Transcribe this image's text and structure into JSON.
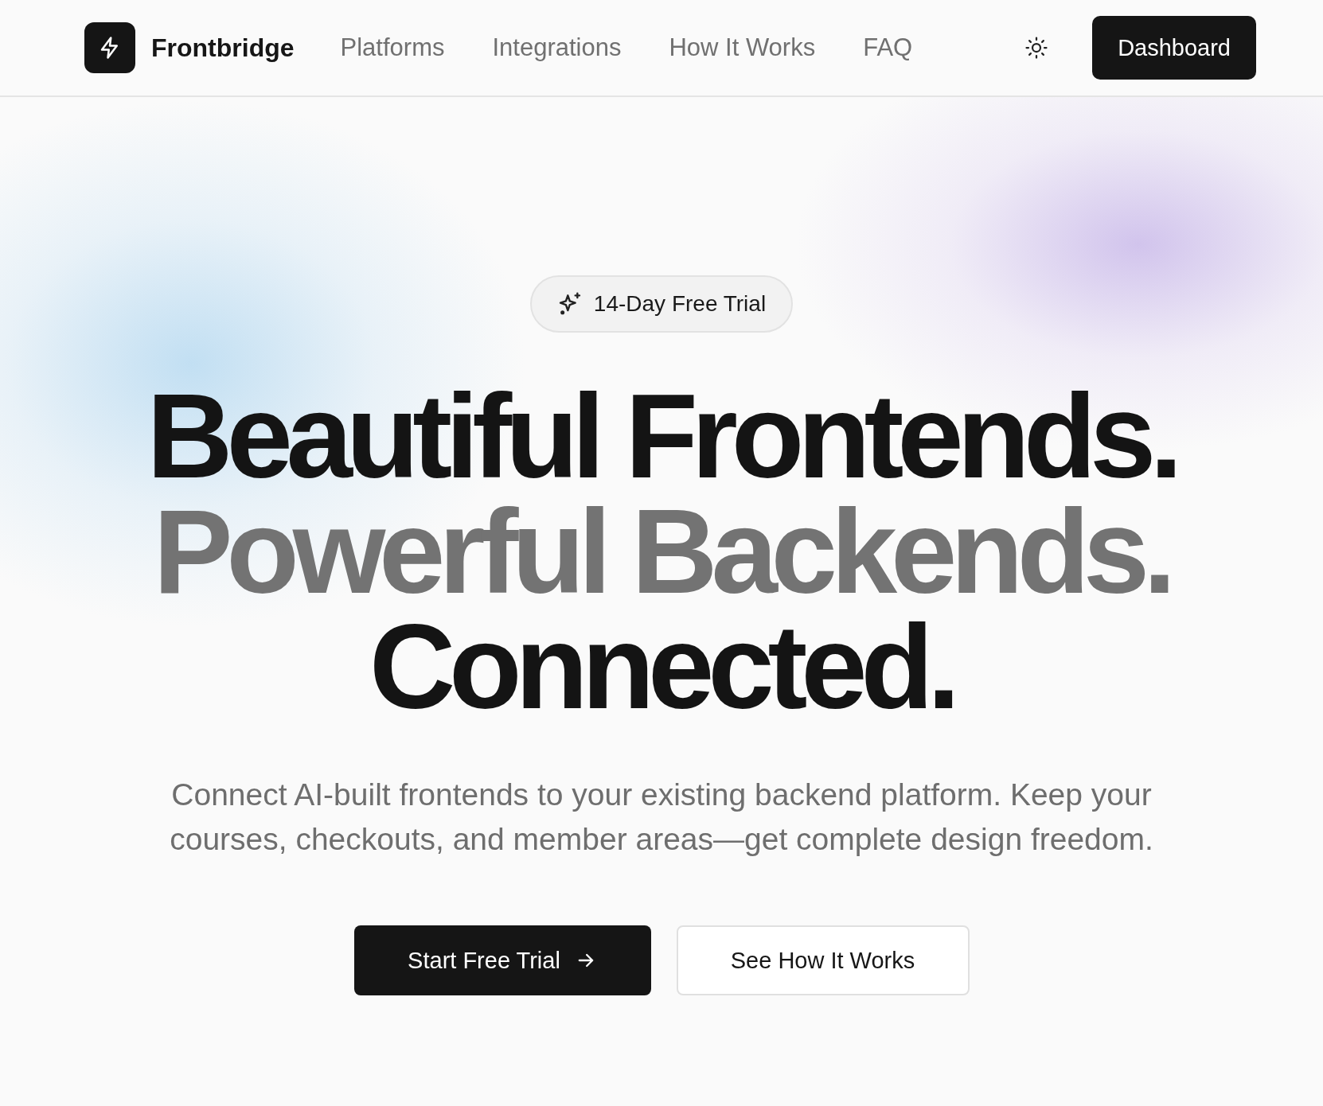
{
  "brand": {
    "name": "Frontbridge"
  },
  "nav": [
    {
      "label": "Platforms"
    },
    {
      "label": "Integrations"
    },
    {
      "label": "How It Works"
    },
    {
      "label": "FAQ"
    }
  ],
  "dashboard_button": "Dashboard",
  "badge": "14-Day Free Trial",
  "headline": [
    {
      "text": "Beautiful Frontends.",
      "kind": "dark"
    },
    {
      "text": "Powerful Backends.",
      "kind": "muted"
    },
    {
      "text": "Connected.",
      "kind": "dark"
    }
  ],
  "subtitle": "Connect AI-built frontends to your existing backend platform. Keep your courses, checkouts, and member areas—get complete design freedom.",
  "buttons": [
    {
      "label": "Start Free Trial",
      "kind": "primary"
    },
    {
      "label": "See How It Works",
      "kind": "secondary"
    }
  ]
}
